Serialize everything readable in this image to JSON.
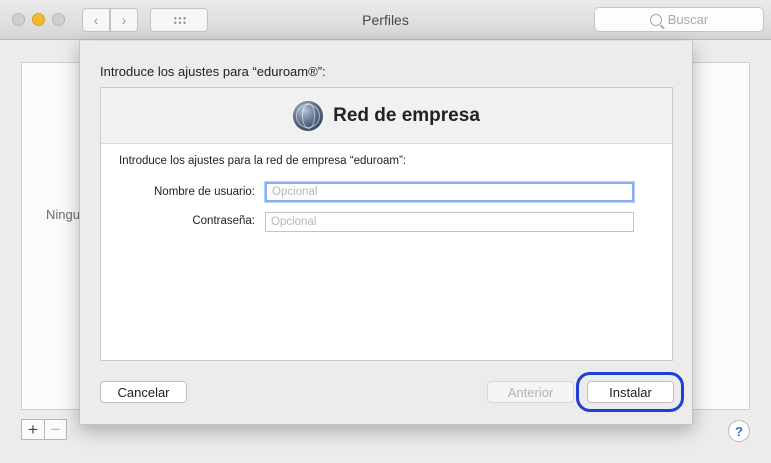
{
  "window": {
    "title": "Perfiles",
    "search_placeholder": "Buscar",
    "back_label": "‹",
    "forward_label": "›"
  },
  "background": {
    "empty_label": "Ningu",
    "add_label": "+",
    "remove_label": "−",
    "help_label": "?"
  },
  "sheet": {
    "heading": "Introduce los ajustes para “eduroam®”:",
    "panel_title": "Red de empresa",
    "intro": "Introduce los ajustes para la red de empresa “eduroam”:",
    "username_label": "Nombre de usuario:",
    "username_placeholder": "Opcional",
    "password_label": "Contraseña:",
    "password_placeholder": "Opcional",
    "cancel_label": "Cancelar",
    "previous_label": "Anterior",
    "install_label": "Instalar"
  },
  "icons": {
    "panel_icon": "globe-icon",
    "search": "search-icon",
    "grid": "grid-icon"
  },
  "colors": {
    "highlight_ring": "#1f3fd6",
    "focus_ring": "#86aef1",
    "minimize": "#f5b82e"
  }
}
